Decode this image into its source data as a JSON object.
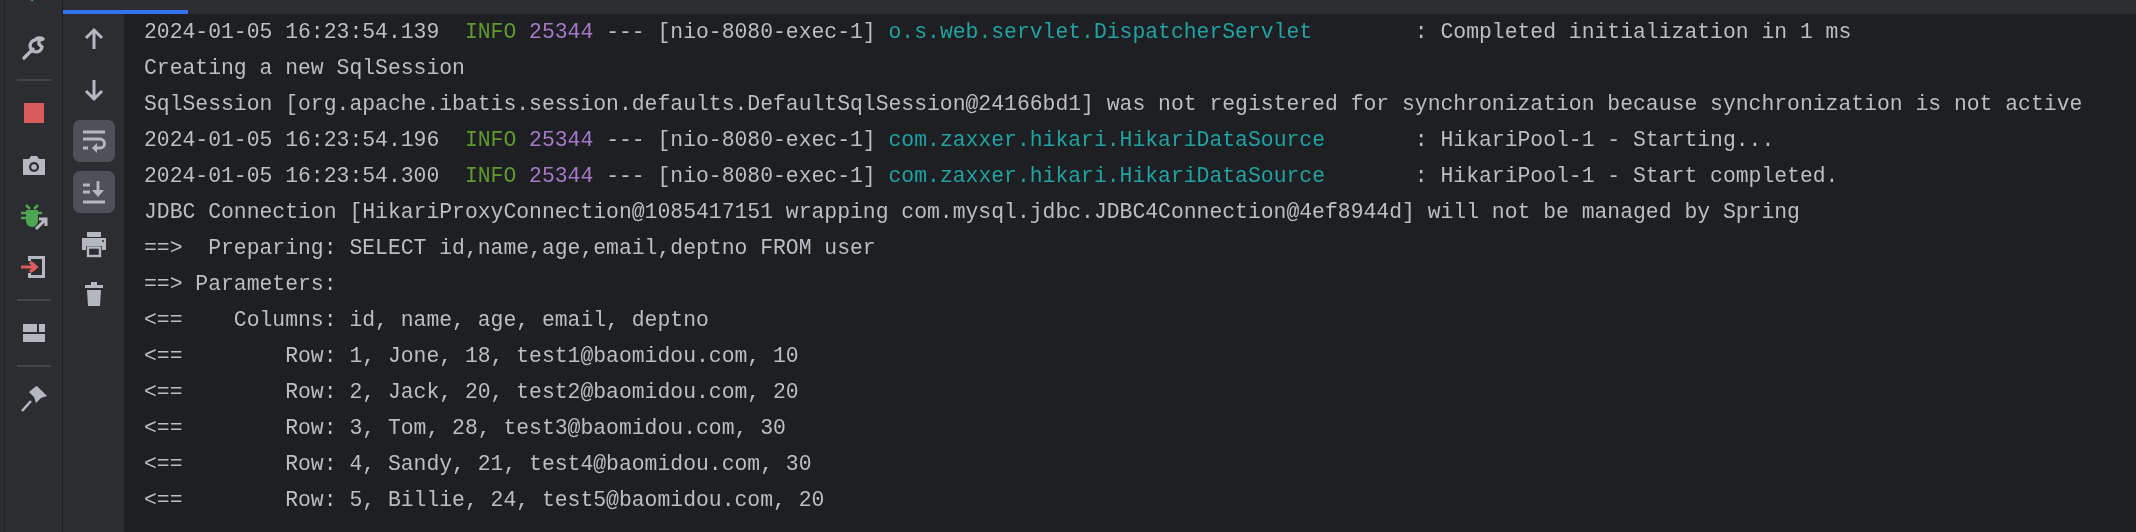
{
  "console_toolbar": [
    {
      "selected": false
    },
    {
      "selected": false
    },
    {
      "selected": true
    },
    {
      "selected": true
    },
    {
      "selected": false
    },
    {
      "selected": false
    }
  ],
  "console": {
    "lines": [
      {
        "kind": "log",
        "timestamp": "2024-01-05 16:23:54.139",
        "level": "INFO",
        "pid": "25344",
        "thread": "--- [nio-8080-exec-1]",
        "logger": "o.s.web.servlet.DispatcherServlet",
        "message": ": Completed initialization in 1 ms"
      },
      {
        "kind": "plain",
        "text": "Creating a new SqlSession"
      },
      {
        "kind": "plain",
        "text": "SqlSession [org.apache.ibatis.session.defaults.DefaultSqlSession@24166bd1] was not registered for synchronization because synchronization is not active"
      },
      {
        "kind": "log",
        "timestamp": "2024-01-05 16:23:54.196",
        "level": "INFO",
        "pid": "25344",
        "thread": "--- [nio-8080-exec-1]",
        "logger": "com.zaxxer.hikari.HikariDataSource",
        "message": ": HikariPool-1 - Starting..."
      },
      {
        "kind": "log",
        "timestamp": "2024-01-05 16:23:54.300",
        "level": "INFO",
        "pid": "25344",
        "thread": "--- [nio-8080-exec-1]",
        "logger": "com.zaxxer.hikari.HikariDataSource",
        "message": ": HikariPool-1 - Start completed."
      },
      {
        "kind": "plain",
        "text": "JDBC Connection [HikariProxyConnection@1085417151 wrapping com.mysql.jdbc.JDBC4Connection@4ef8944d] will not be managed by Spring"
      },
      {
        "kind": "plain",
        "text": "==>  Preparing: SELECT id,name,age,email,deptno FROM user"
      },
      {
        "kind": "plain",
        "text": "==> Parameters: "
      },
      {
        "kind": "plain",
        "text": "<==    Columns: id, name, age, email, deptno"
      },
      {
        "kind": "plain",
        "text": "<==        Row: 1, Jone, 18, test1@baomidou.com, 10"
      },
      {
        "kind": "plain",
        "text": "<==        Row: 2, Jack, 20, test2@baomidou.com, 20"
      },
      {
        "kind": "plain",
        "text": "<==        Row: 3, Tom, 28, test3@baomidou.com, 30"
      },
      {
        "kind": "plain",
        "text": "<==        Row: 4, Sandy, 21, test4@baomidou.com, 30"
      },
      {
        "kind": "plain",
        "text": "<==        Row: 5, Billie, 24, test5@baomidou.com, 20"
      }
    ]
  }
}
